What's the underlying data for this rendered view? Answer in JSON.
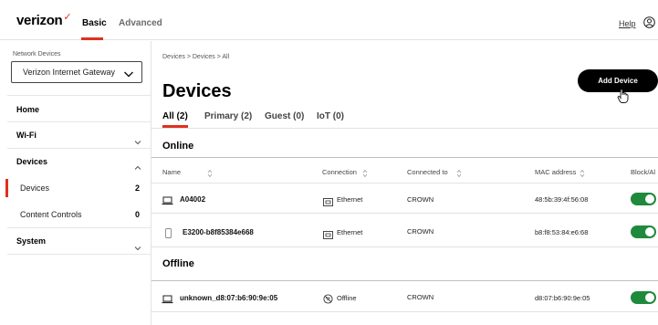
{
  "header": {
    "logo_text": "verizon",
    "logo_mark": "✓",
    "tabs": [
      {
        "label": "Basic",
        "active": true
      },
      {
        "label": "Advanced",
        "active": false
      }
    ],
    "help_label": "Help",
    "user_icon": "user-circle-icon"
  },
  "sidebar": {
    "network_devices_label": "Network Devices",
    "selected_device": "Verizon Internet Gateway",
    "items": [
      {
        "label": "Home"
      },
      {
        "label": "Wi-Fi",
        "expandable": true,
        "expanded": false
      },
      {
        "label": "Devices",
        "expandable": true,
        "expanded": true
      },
      {
        "label": "Devices",
        "sub": true,
        "active": true,
        "count": "2"
      },
      {
        "label": "Content Controls",
        "sub": true,
        "count": "0"
      },
      {
        "label": "System",
        "expandable": true,
        "expanded": false
      }
    ]
  },
  "main": {
    "breadcrumb": "Devices  >  Devices  >  All",
    "title": "Devices",
    "add_button": "Add Device",
    "tabs": [
      {
        "label": "All (2)",
        "active": true
      },
      {
        "label": "Primary (2)"
      },
      {
        "label": "Guest (0)"
      },
      {
        "label": "IoT (0)"
      }
    ],
    "online_label": "Online",
    "offline_label": "Offline",
    "columns": [
      "Name",
      "Connection",
      "Connected to",
      "MAC address",
      "Block/Al"
    ],
    "online_devices": [
      {
        "name": "A04002",
        "icon": "laptop-icon",
        "connection": "Ethernet",
        "connected_to": "CROWN",
        "mac": "48:5b:39:4f:56:08",
        "allowed": true
      },
      {
        "name": "E3200-b8f85384e668",
        "icon": "phone-icon",
        "connection": "Ethernet",
        "connected_to": "CROWN",
        "mac": "b8:f8:53:84:e6:68",
        "allowed": true
      }
    ],
    "offline_devices": [
      {
        "name": "unknown_d8:07:b6:90:9e:05",
        "icon": "laptop-icon",
        "connection": "Offline",
        "connected_to": "CROWN",
        "mac": "d8:07:b6:90:9e:05",
        "allowed": true
      }
    ]
  },
  "colors": {
    "accent": "#e0301e",
    "toggle_on": "#1f8a3c",
    "button_bg": "#000000"
  }
}
